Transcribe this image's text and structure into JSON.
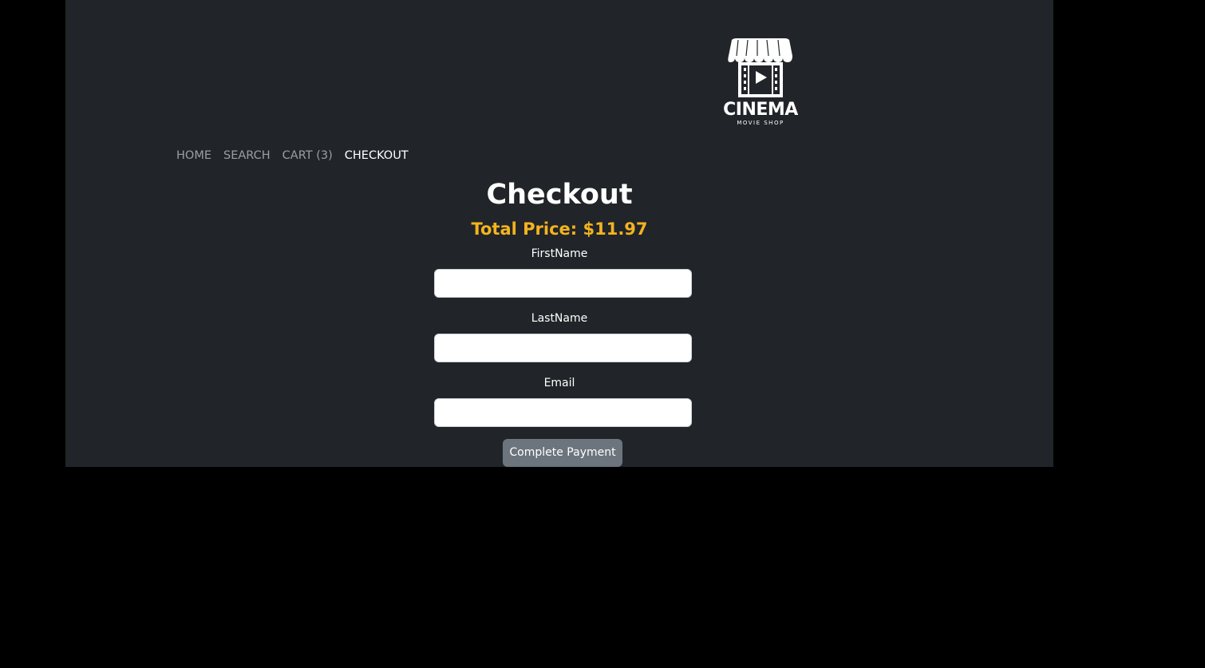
{
  "brand": {
    "name": "CINEMA",
    "tagline": "MOVIE SHOP",
    "logo_icon": "cinema-storefront-play-icon"
  },
  "nav": {
    "items": [
      {
        "label": "HOME",
        "active": false
      },
      {
        "label": "SEARCH",
        "active": false
      },
      {
        "label": "CART (3)",
        "active": false
      },
      {
        "label": "CHECKOUT",
        "active": true
      }
    ]
  },
  "checkout": {
    "title": "Checkout",
    "total_price": "Total Price: $11.97",
    "fields": [
      {
        "label": "FirstName",
        "value": "",
        "placeholder": ""
      },
      {
        "label": "LastName",
        "value": "",
        "placeholder": ""
      },
      {
        "label": "Email",
        "value": "",
        "placeholder": ""
      }
    ],
    "submit_label": "Complete Payment"
  },
  "colors": {
    "page_background": "#000000",
    "panel_background": "#212529",
    "accent_price": "#f4b31f",
    "button_background": "#6c757d"
  }
}
